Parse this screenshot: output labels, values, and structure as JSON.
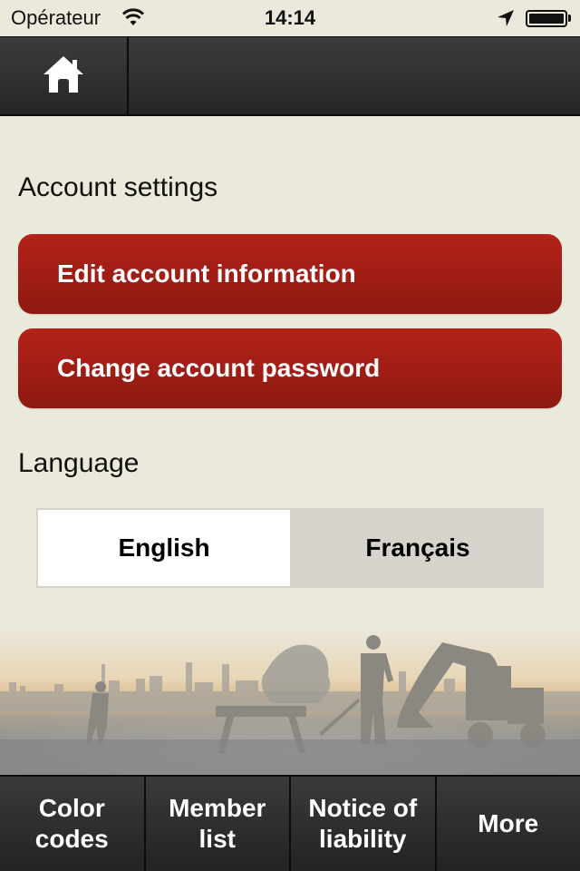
{
  "status_bar": {
    "carrier": "Opérateur",
    "time": "14:14",
    "battery_level": 1.0
  },
  "nav_bar": {
    "home_icon": "home-icon"
  },
  "account": {
    "title": "Account settings",
    "edit_button": "Edit account information",
    "password_button": "Change account password"
  },
  "language": {
    "title": "Language",
    "options": [
      "English",
      "Français"
    ],
    "selected": "English"
  },
  "tabs": [
    {
      "line1": "Color",
      "line2": "codes"
    },
    {
      "line1": "Member",
      "line2": "list"
    },
    {
      "line1": "Notice of",
      "line2": "liability"
    },
    {
      "line1": "More",
      "line2": ""
    }
  ],
  "colors": {
    "background": "#ebe8dc",
    "button_red": "#a01e15",
    "segment_unselected": "#d5d3cb"
  }
}
